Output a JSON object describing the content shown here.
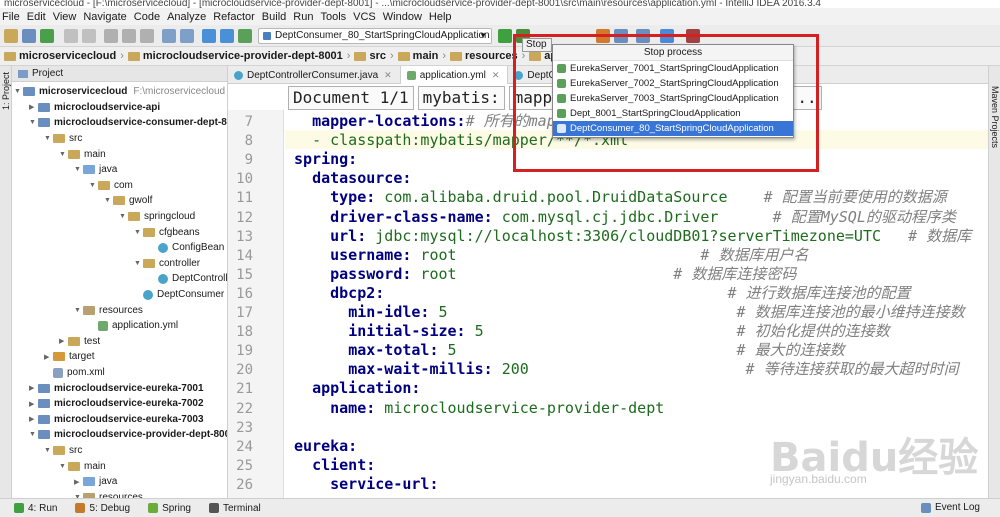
{
  "window": {
    "title": "microservicecloud - [F:\\microservicecloud] - [microcloudservice-provider-dept-8001] - ...\\microcloudservice-provider-dept-8001\\src\\main\\resources\\application.yml - IntelliJ IDEA 2016.3.4"
  },
  "menu": [
    "File",
    "Edit",
    "View",
    "Navigate",
    "Code",
    "Analyze",
    "Refactor",
    "Build",
    "Run",
    "Tools",
    "VCS",
    "Window",
    "Help"
  ],
  "toolbar": {
    "run_config": "DeptConsumer_80_StartSpringCloudApplication",
    "stop_tooltip": "Stop"
  },
  "breadcrumb": [
    "microservicecloud",
    "microcloudservice-provider-dept-8001",
    "src",
    "main",
    "resources",
    "application.yml"
  ],
  "project_panel": {
    "header": "Project",
    "items": [
      {
        "label": "microservicecloud",
        "suffix": "F:\\microservicecloud",
        "icon": "module",
        "depth": 0,
        "arrow": "down",
        "bold": true
      },
      {
        "label": "microcloudservice-api",
        "icon": "module",
        "depth": 1,
        "arrow": "right",
        "bold": true
      },
      {
        "label": "microcloudservice-consumer-dept-80",
        "icon": "module",
        "depth": 1,
        "arrow": "down",
        "bold": true
      },
      {
        "label": "src",
        "icon": "folder",
        "depth": 2,
        "arrow": "down"
      },
      {
        "label": "main",
        "icon": "folder",
        "depth": 3,
        "arrow": "down"
      },
      {
        "label": "java",
        "icon": "source",
        "depth": 4,
        "arrow": "down"
      },
      {
        "label": "com",
        "icon": "folder",
        "depth": 5,
        "arrow": "down"
      },
      {
        "label": "gwolf",
        "icon": "folder",
        "depth": 6,
        "arrow": "down"
      },
      {
        "label": "springcloud",
        "icon": "folder",
        "depth": 7,
        "arrow": "down"
      },
      {
        "label": "cfgbeans",
        "icon": "folder",
        "depth": 8,
        "arrow": "down"
      },
      {
        "label": "ConfigBean",
        "icon": "class",
        "depth": 9,
        "arrow": ""
      },
      {
        "label": "controller",
        "icon": "folder",
        "depth": 8,
        "arrow": "down"
      },
      {
        "label": "DeptController",
        "icon": "class",
        "depth": 9,
        "arrow": ""
      },
      {
        "label": "DeptConsumer",
        "icon": "class",
        "depth": 8,
        "arrow": ""
      },
      {
        "label": "resources",
        "icon": "resources",
        "depth": 4,
        "arrow": "down"
      },
      {
        "label": "application.yml",
        "icon": "yml",
        "depth": 5,
        "arrow": ""
      },
      {
        "label": "test",
        "icon": "folder",
        "depth": 3,
        "arrow": "right"
      },
      {
        "label": "target",
        "icon": "target",
        "depth": 2,
        "arrow": "right"
      },
      {
        "label": "pom.xml",
        "icon": "xml",
        "depth": 2,
        "arrow": ""
      },
      {
        "label": "microcloudservice-eureka-7001",
        "icon": "module",
        "depth": 1,
        "arrow": "right",
        "bold": true
      },
      {
        "label": "microcloudservice-eureka-7002",
        "icon": "module",
        "depth": 1,
        "arrow": "right",
        "bold": true
      },
      {
        "label": "microcloudservice-eureka-7003",
        "icon": "module",
        "depth": 1,
        "arrow": "right",
        "bold": true
      },
      {
        "label": "microcloudservice-provider-dept-8001",
        "icon": "module",
        "depth": 1,
        "arrow": "down",
        "bold": true
      },
      {
        "label": "src",
        "icon": "folder",
        "depth": 2,
        "arrow": "down"
      },
      {
        "label": "main",
        "icon": "folder",
        "depth": 3,
        "arrow": "down"
      },
      {
        "label": "java",
        "icon": "source",
        "depth": 4,
        "arrow": "right"
      },
      {
        "label": "resources",
        "icon": "resources",
        "depth": 4,
        "arrow": "down"
      }
    ]
  },
  "tabs": [
    {
      "label": "DeptControllerConsumer.java",
      "kind": "class",
      "active": false
    },
    {
      "label": "application.yml",
      "kind": "yml",
      "active": true
    },
    {
      "label": "DeptContr",
      "kind": "class",
      "active": false
    }
  ],
  "editor": {
    "docbar": [
      "Document 1/1",
      "mybatis:",
      "mapper",
      "classpath:/mybatis/ma..."
    ],
    "lines": [
      {
        "n": "7",
        "indent": "  ",
        "key": "mapper-locations:",
        "val": "",
        "comment": "# 所有的mapper映射文件"
      },
      {
        "n": "8",
        "indent": "  ",
        "key": "",
        "val": "- classpath:mybatis/mapper/**/*.xml",
        "comment": ""
      },
      {
        "n": "9",
        "indent": "",
        "key": "spring:",
        "val": "",
        "comment": ""
      },
      {
        "n": "10",
        "indent": "  ",
        "key": "datasource:",
        "val": "",
        "comment": ""
      },
      {
        "n": "11",
        "indent": "    ",
        "key": "type:",
        "val": " com.alibaba.druid.pool.DruidDataSource",
        "comment": "    # 配置当前要使用的数据源"
      },
      {
        "n": "12",
        "indent": "    ",
        "key": "driver-class-name:",
        "val": " com.mysql.cj.jdbc.Driver",
        "comment": "      # 配置MySQL的驱动程序类"
      },
      {
        "n": "13",
        "indent": "    ",
        "key": "url:",
        "val": " jdbc:mysql://localhost:3306/cloudDB01?serverTimezone=UTC",
        "comment": "   # 数据库"
      },
      {
        "n": "14",
        "indent": "    ",
        "key": "username:",
        "val": " root",
        "comment": "                           # 数据库用户名"
      },
      {
        "n": "15",
        "indent": "    ",
        "key": "password:",
        "val": " root",
        "comment": "                        # 数据库连接密码"
      },
      {
        "n": "16",
        "indent": "    ",
        "key": "dbcp2:",
        "val": "",
        "comment": "                                      # 进行数据库连接池的配置"
      },
      {
        "n": "17",
        "indent": "      ",
        "key": "min-idle:",
        "val": " 5",
        "comment": "                                # 数据库连接池的最小维持连接数"
      },
      {
        "n": "18",
        "indent": "      ",
        "key": "initial-size:",
        "val": " 5",
        "comment": "                            # 初始化提供的连接数"
      },
      {
        "n": "19",
        "indent": "      ",
        "key": "max-total:",
        "val": " 5",
        "comment": "                               # 最大的连接数"
      },
      {
        "n": "20",
        "indent": "      ",
        "key": "max-wait-millis:",
        "val": " 200",
        "comment": "                        # 等待连接获取的最大超时时间"
      },
      {
        "n": "21",
        "indent": "  ",
        "key": "application:",
        "val": "",
        "comment": ""
      },
      {
        "n": "22",
        "indent": "    ",
        "key": "name:",
        "val": " microcloudservice-provider-dept",
        "comment": ""
      },
      {
        "n": "23",
        "indent": "",
        "key": "",
        "val": "",
        "comment": ""
      },
      {
        "n": "24",
        "indent": "",
        "key": "eureka:",
        "val": "",
        "comment": ""
      },
      {
        "n": "25",
        "indent": "  ",
        "key": "client:",
        "val": "",
        "comment": ""
      },
      {
        "n": "26",
        "indent": "    ",
        "key": "service-url:",
        "val": "",
        "comment": ""
      }
    ]
  },
  "stop_popup": {
    "title": "Stop process",
    "items": [
      {
        "label": "EurekaServer_7001_StartSpringCloudApplication",
        "selected": false
      },
      {
        "label": "EurekaServer_7002_StartSpringCloudApplication",
        "selected": false
      },
      {
        "label": "EurekaServer_7003_StartSpringCloudApplication",
        "selected": false
      },
      {
        "label": "Dept_8001_StartSpringCloudApplication",
        "selected": false
      },
      {
        "label": "DeptConsumer_80_StartSpringCloudApplication",
        "selected": true
      }
    ]
  },
  "right_strip": {
    "label": "Maven Projects"
  },
  "left_strip": {
    "label": "1: Project"
  },
  "statusbar": {
    "items": [
      {
        "label": "4: Run",
        "color": "#3ea03e"
      },
      {
        "label": "5: Debug",
        "color": "#c47a2a"
      },
      {
        "label": "Spring",
        "color": "#6aab3a"
      },
      {
        "label": "Terminal",
        "color": "#555555"
      }
    ],
    "event_log": "Event Log"
  },
  "watermark": {
    "main": "Baidu经验",
    "sub": "jingyan.baidu.com"
  },
  "colors": {
    "highlight_box": "#d42020",
    "selection": "#3875d7",
    "keyword": "#000080",
    "value": "#1d6c1d",
    "comment": "#808080"
  }
}
